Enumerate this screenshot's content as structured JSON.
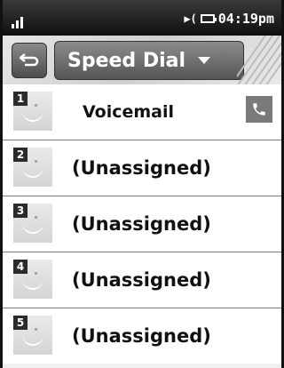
{
  "status": {
    "time": "04:19pm"
  },
  "header": {
    "title": "Speed Dial"
  },
  "entries": [
    {
      "slot": "1",
      "label": "Voicemail",
      "has_call": true
    },
    {
      "slot": "2",
      "label": "(Unassigned)"
    },
    {
      "slot": "3",
      "label": "(Unassigned)"
    },
    {
      "slot": "4",
      "label": "(Unassigned)"
    },
    {
      "slot": "5",
      "label": "(Unassigned)"
    }
  ]
}
